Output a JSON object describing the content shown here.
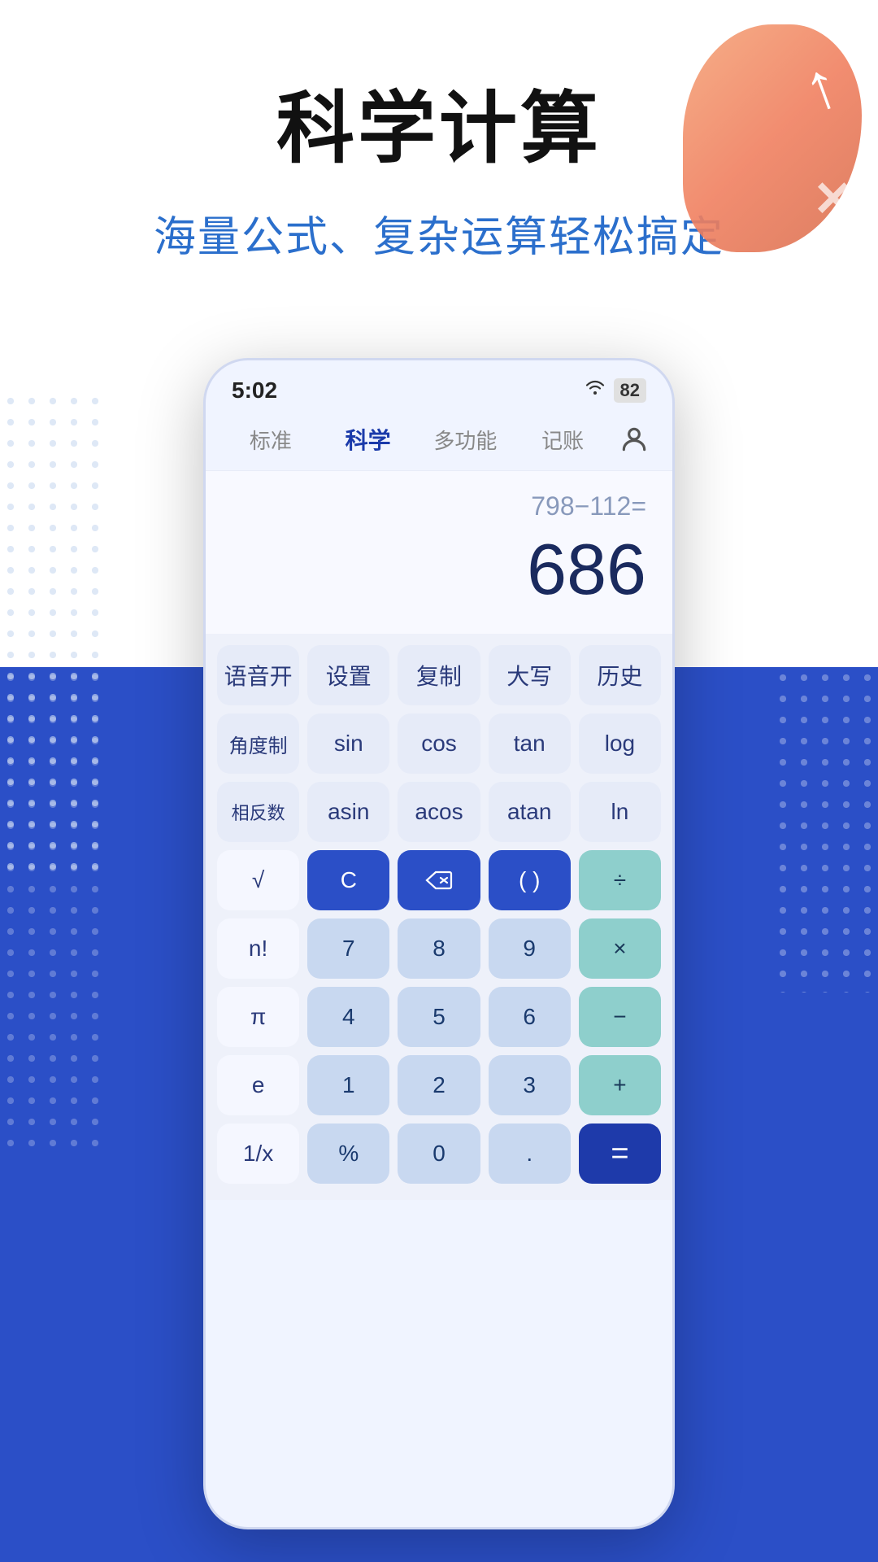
{
  "header": {
    "main_title": "科学计算",
    "subtitle": "海量公式、复杂运算轻松搞定"
  },
  "status_bar": {
    "time": "5:02",
    "wifi": "📶",
    "battery": "82"
  },
  "nav": {
    "tabs": [
      "标准",
      "科学",
      "多功能",
      "记账"
    ],
    "active_tab": "科学"
  },
  "display": {
    "expression": "798−112=",
    "result": "686"
  },
  "keypad": {
    "row1": [
      "语音开",
      "设置",
      "复制",
      "大写",
      "历史"
    ],
    "row2": [
      "角度制",
      "sin",
      "cos",
      "tan",
      "log"
    ],
    "row3": [
      "相反数",
      "asin",
      "acos",
      "atan",
      "ln"
    ],
    "row4": [
      "√",
      "C",
      "⌫",
      "( )",
      "÷"
    ],
    "row5": [
      "n!",
      "7",
      "8",
      "9",
      "×"
    ],
    "row6": [
      "π",
      "4",
      "5",
      "6",
      "−"
    ],
    "row7": [
      "e",
      "1",
      "2",
      "3",
      "+"
    ],
    "row8": [
      "1/x",
      "%",
      "0",
      ".",
      "="
    ]
  }
}
